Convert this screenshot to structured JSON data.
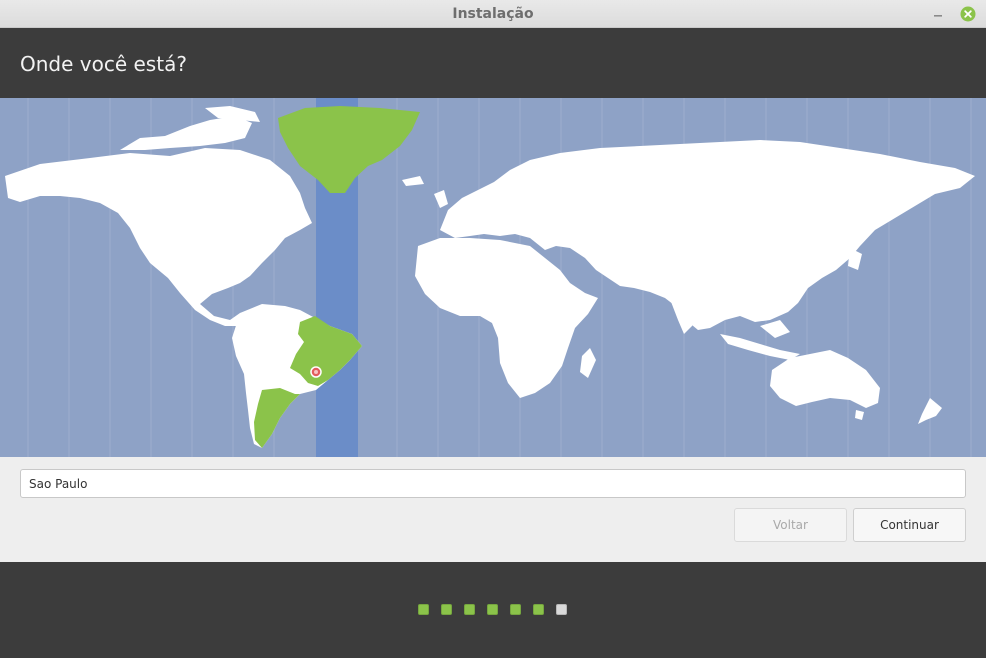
{
  "window": {
    "title": "Instalação",
    "minimize_icon": "minimize-icon",
    "close_icon": "close-icon",
    "accent": "#8bc34a"
  },
  "header": {
    "title": "Onde você está?"
  },
  "map": {
    "selected_city": "Sao Paulo",
    "highlight_color": "#8bc34a",
    "timezone_band_color": "#6b8dc8",
    "ocean_color": "#8ea2c6",
    "land_color": "#ffffff"
  },
  "timezone": {
    "value": "Sao Paulo"
  },
  "buttons": {
    "back_label": "Voltar",
    "continue_label": "Continuar"
  },
  "progress": {
    "steps_total": 7,
    "current_step": 7,
    "done_color": "#8bc34a",
    "current_color": "#d9d9d9"
  }
}
